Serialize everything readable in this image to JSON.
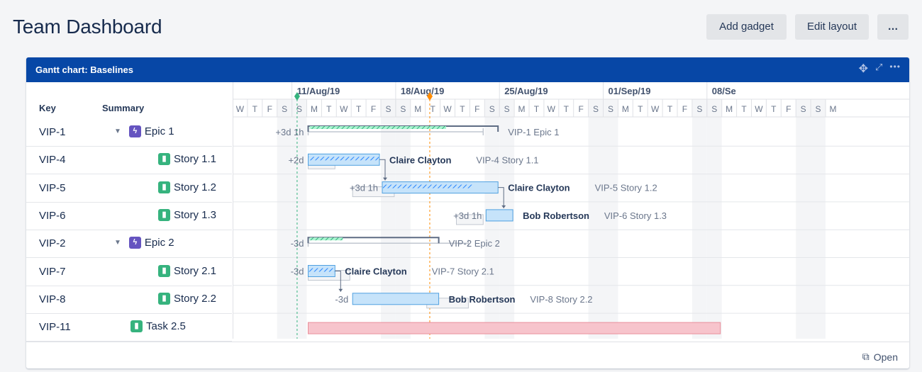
{
  "page": {
    "title": "Team Dashboard"
  },
  "toolbar": {
    "add_gadget": "Add gadget",
    "edit_layout": "Edit layout",
    "more": "…"
  },
  "gadget": {
    "title": "Gantt chart: Baselines",
    "icons": [
      "move-icon",
      "expand-icon",
      "more-icon"
    ],
    "columns": {
      "key": "Key",
      "summary": "Summary"
    },
    "rows": [
      {
        "key": "VIP-1",
        "summary": "Epic 1",
        "type": "epic",
        "level": 0,
        "expandable": true
      },
      {
        "key": "VIP-4",
        "summary": "Story 1.1",
        "type": "story",
        "level": 1,
        "expandable": false
      },
      {
        "key": "VIP-5",
        "summary": "Story 1.2",
        "type": "story",
        "level": 1,
        "expandable": false
      },
      {
        "key": "VIP-6",
        "summary": "Story 1.3",
        "type": "story",
        "level": 1,
        "expandable": false
      },
      {
        "key": "VIP-2",
        "summary": "Epic 2",
        "type": "epic",
        "level": 0,
        "expandable": true
      },
      {
        "key": "VIP-7",
        "summary": "Story 2.1",
        "type": "story",
        "level": 1,
        "expandable": false
      },
      {
        "key": "VIP-8",
        "summary": "Story 2.2",
        "type": "story",
        "level": 1,
        "expandable": false
      },
      {
        "key": "VIP-11",
        "summary": "Task 2.5",
        "type": "task",
        "level": 0.5,
        "expandable": false
      }
    ],
    "footer": {
      "open_label": "Open"
    }
  },
  "timeline": {
    "weeks": [
      "11/Aug/19",
      "18/Aug/19",
      "25/Aug/19",
      "01/Sep/19",
      "08/Se"
    ],
    "first_day": "2019-08-07",
    "days": [
      "W",
      "T",
      "F",
      "S",
      "S",
      "M",
      "T",
      "W",
      "T",
      "F",
      "S",
      "S",
      "M",
      "T",
      "W",
      "T",
      "F",
      "S",
      "S",
      "M",
      "T",
      "W",
      "T",
      "F",
      "S",
      "S",
      "M",
      "T",
      "W",
      "T",
      "F",
      "S",
      "S",
      "M",
      "T",
      "W",
      "T",
      "F",
      "S",
      "S",
      "M"
    ],
    "today": "2019-08-11",
    "marker": "2019-08-20"
  },
  "tasks": [
    {
      "row": 0,
      "kind": "epic",
      "start": "2019-08-12",
      "end": "2019-08-24",
      "baseline_start": "2019-08-12",
      "baseline_end": "2019-08-23",
      "progress": 0.73,
      "delta": "+3d 1h",
      "assignee": "",
      "label": "VIP-1  Epic 1"
    },
    {
      "row": 1,
      "kind": "story",
      "start": "2019-08-12",
      "end": "2019-08-16",
      "baseline_start": "2019-08-12",
      "baseline_end": "2019-08-13",
      "progress": 1.0,
      "delta": "+2d",
      "assignee": "Claire Clayton",
      "label": "VIP-4  Story 1.1"
    },
    {
      "row": 2,
      "kind": "story",
      "start": "2019-08-17",
      "end": "2019-08-24",
      "baseline_start": "2019-08-15",
      "baseline_end": "2019-08-17",
      "progress": 0.78,
      "delta": "+3d 1h",
      "assignee": "Claire Clayton",
      "label": "VIP-5  Story 1.2"
    },
    {
      "row": 3,
      "kind": "story",
      "start": "2019-08-24",
      "end": "2019-08-25",
      "baseline_start": "2019-08-22",
      "baseline_end": "2019-08-23",
      "progress": 0.0,
      "delta": "+3d 1h",
      "assignee": "Bob Robertson",
      "label": "VIP-6  Story 1.3"
    },
    {
      "row": 4,
      "kind": "epic",
      "start": "2019-08-12",
      "end": "2019-08-20",
      "baseline_start": "2019-08-12",
      "baseline_end": "2019-08-22",
      "progress": 0.26,
      "delta": "-3d",
      "assignee": "",
      "label": "VIP-2  Epic 2"
    },
    {
      "row": 5,
      "kind": "story",
      "start": "2019-08-12",
      "end": "2019-08-13",
      "baseline_start": "2019-08-12",
      "baseline_end": "2019-08-14",
      "progress": 1.0,
      "delta": "-3d",
      "assignee": "Claire Clayton",
      "label": "VIP-7  Story 2.1"
    },
    {
      "row": 6,
      "kind": "story",
      "start": "2019-08-15",
      "end": "2019-08-20",
      "baseline_start": "2019-08-20",
      "baseline_end": "2019-08-22",
      "progress": 0.0,
      "delta": "-3d",
      "assignee": "Bob Robertson",
      "label": "VIP-8  Story 2.2"
    },
    {
      "row": 7,
      "kind": "task",
      "start": "2019-08-12",
      "end": "2019-09-08",
      "baseline_start": "",
      "baseline_end": "",
      "progress": 0.0,
      "delta": "",
      "assignee": "",
      "label": ""
    }
  ],
  "dependencies": [
    {
      "from": 1,
      "to": 2
    },
    {
      "from": 2,
      "to": 3
    },
    {
      "from": 5,
      "to": 6
    }
  ],
  "colors": {
    "header_bg": "#0747a6",
    "story_bar": "#c6e3fa",
    "story_border": "#4fa0e0",
    "epic_line": "#5e6c84",
    "epic_progress": "#57d9a3",
    "task_bar": "#f7c4cc",
    "today_line": "#36b37e",
    "marker_line": "#ff8b00"
  }
}
